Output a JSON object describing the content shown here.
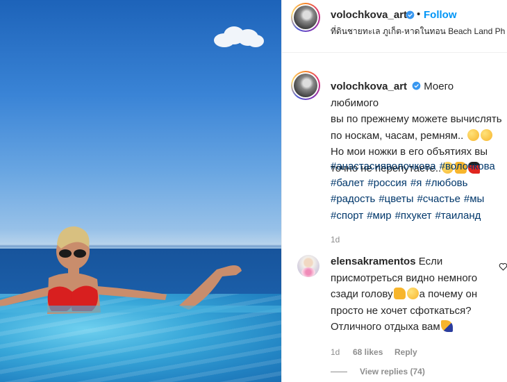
{
  "post": {
    "username": "volochkova_art",
    "follow_label": "Follow",
    "separator": "•",
    "location": "ที่ดินชายทะเล ภูเก็ต-หาดในทอน Beach Land Ph"
  },
  "caption": {
    "username": "volochkova_art",
    "line1": "Моего любимого",
    "line2": "вы по прежнему можете вычислять",
    "line3": "по носкам, часам, ремням..",
    "line4": "Но мои ножки в его объятиях вы",
    "line5": "точно не перепутаете..",
    "hashtags": [
      "#анастасияволочкова",
      "#волочкова",
      "#балет",
      "#россия",
      "#я",
      "#любовь",
      "#радость",
      "#цветы",
      "#счастье",
      "#мы",
      "#спорт",
      "#мир",
      "#пхукет",
      "#таиланд"
    ],
    "time": "1d"
  },
  "comment": {
    "username": "elensakramentos",
    "line1": "Если",
    "line2": "присмотреться видно немного",
    "line3": "сзади голову",
    "line3b": "а почему он",
    "line4": "просто не хочет сфоткаться?",
    "line5": "Отличного отдыха вам",
    "time": "1d",
    "likes": "68 likes",
    "reply_label": "Reply",
    "view_replies": "View replies (74)"
  },
  "icons": {
    "verified": "verified-badge-icon",
    "heart": "heart-outline-icon"
  },
  "colors": {
    "link": "#0095f6",
    "hashtag": "#00376b",
    "muted": "#8e8e8e"
  }
}
